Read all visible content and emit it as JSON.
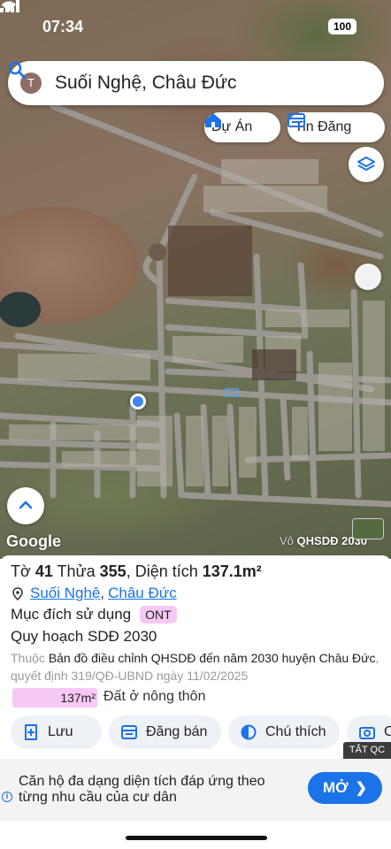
{
  "status_bar": {
    "time": "07:34",
    "battery": "100"
  },
  "search": {
    "avatar_letter": "T",
    "query": "Suối Nghệ, Châu Đức"
  },
  "chips": {
    "du_an": "Dự Án",
    "tin_dang": "Tin Đăng"
  },
  "map": {
    "google_label": "Google",
    "caption_prefix": "Vô",
    "caption": "QHSDĐ 2030"
  },
  "parcel": {
    "sheet_label": "Tờ",
    "sheet_no": "41",
    "lot_label": "Thửa",
    "lot_no": "355",
    "area_label": ", Diện tích",
    "area_value": "137.1m²",
    "commune": "Suối Nghệ",
    "district": "Châu Đức",
    "purpose_label": "Mục đích sử dụng",
    "purpose_code": "ONT",
    "plan": "Quy hoạch SDĐ 2030",
    "belongs_prefix": "Thuộc",
    "belongs_map": "Bản đồ điều chỉnh QHSDĐ đến năm 2030 huyện Châu Đức",
    "decision": ", quyết định 319/QĐ-UBND ngày 11/02/2025",
    "area_badge": "137m²",
    "land_type": "Đất ở nông thôn"
  },
  "actions": {
    "save": "Lưu",
    "post": "Đăng bán",
    "legend": "Chú thích",
    "more": "C"
  },
  "ad": {
    "tag": "TẮT QC",
    "text": "Căn hộ đa dạng diện tích đáp ứng theo từng nhu cầu của cư dân",
    "button": "MỞ",
    "info": "i"
  },
  "colors": {
    "accent": "#1a73e8",
    "ont": "#f7c8f4",
    "location_dot": "#4285f4"
  }
}
